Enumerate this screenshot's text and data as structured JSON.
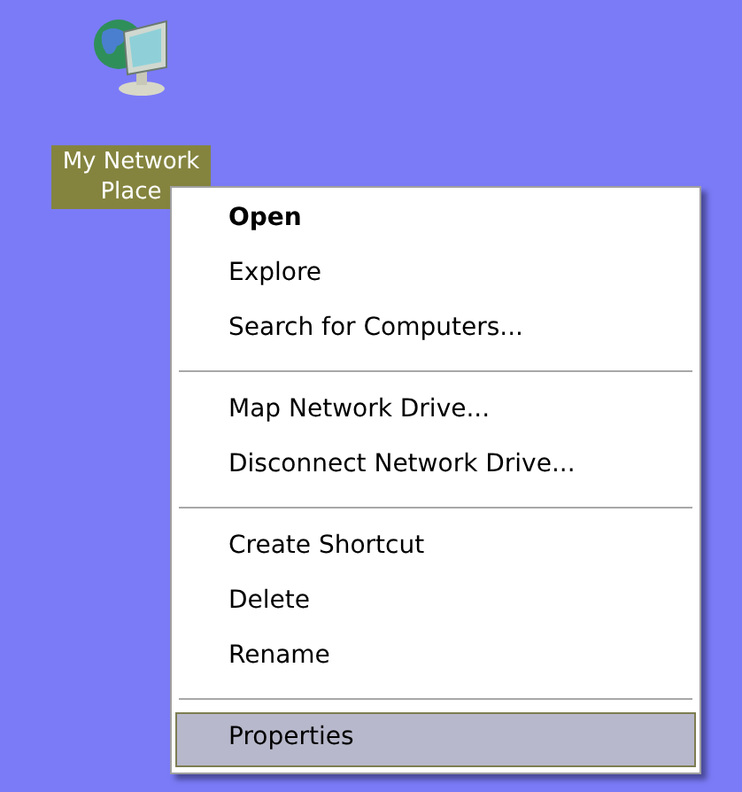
{
  "desktop_icon": {
    "label": "My Network Place",
    "selected": true
  },
  "context_menu": {
    "items": [
      {
        "kind": "item",
        "label": "Open",
        "default": true,
        "selected": false
      },
      {
        "kind": "item",
        "label": "Explore",
        "default": false,
        "selected": false
      },
      {
        "kind": "item",
        "label": "Search for Computers...",
        "default": false,
        "selected": false
      },
      {
        "kind": "separator"
      },
      {
        "kind": "item",
        "label": "Map Network Drive...",
        "default": false,
        "selected": false
      },
      {
        "kind": "item",
        "label": "Disconnect Network Drive...",
        "default": false,
        "selected": false
      },
      {
        "kind": "separator"
      },
      {
        "kind": "item",
        "label": "Create Shortcut",
        "default": false,
        "selected": false
      },
      {
        "kind": "item",
        "label": "Delete",
        "default": false,
        "selected": false
      },
      {
        "kind": "item",
        "label": "Rename",
        "default": false,
        "selected": false
      },
      {
        "kind": "separator"
      },
      {
        "kind": "item",
        "label": "Properties",
        "default": false,
        "selected": true
      }
    ]
  }
}
